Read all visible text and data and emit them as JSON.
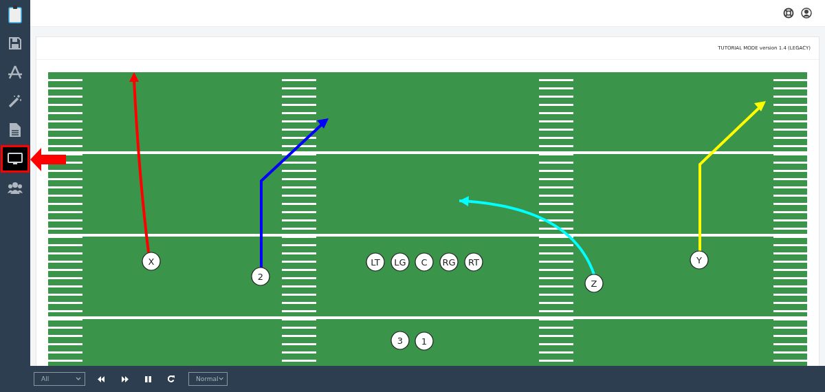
{
  "sidebar": {
    "items": [
      {
        "kind": "clipboard",
        "selected": false
      },
      {
        "kind": "save",
        "selected": false
      },
      {
        "kind": "design",
        "selected": false
      },
      {
        "kind": "wand",
        "selected": false
      },
      {
        "kind": "document",
        "selected": false
      },
      {
        "kind": "monitor",
        "selected": true
      },
      {
        "kind": "users",
        "selected": false
      }
    ]
  },
  "header": {
    "icons": [
      {
        "kind": "help"
      },
      {
        "kind": "account"
      }
    ]
  },
  "card": {
    "version": "TUTORIAL MODE version 1.4 (LEGACY)"
  },
  "field": {
    "players": [
      {
        "label": "X",
        "color": "#ff0000"
      },
      {
        "label": "2",
        "color": "#0000ff"
      },
      {
        "label": "LT"
      },
      {
        "label": "LG"
      },
      {
        "label": "C"
      },
      {
        "label": "RG"
      },
      {
        "label": "RT"
      },
      {
        "label": "Z",
        "color": "#00ffff"
      },
      {
        "label": "Y",
        "color": "#ffff00"
      },
      {
        "label": "3"
      },
      {
        "label": "1"
      }
    ]
  },
  "controls": {
    "filter": "All",
    "speed": "Normal",
    "buttons": [
      {
        "kind": "rewind"
      },
      {
        "kind": "forward"
      },
      {
        "kind": "pause"
      },
      {
        "kind": "restart"
      }
    ]
  }
}
